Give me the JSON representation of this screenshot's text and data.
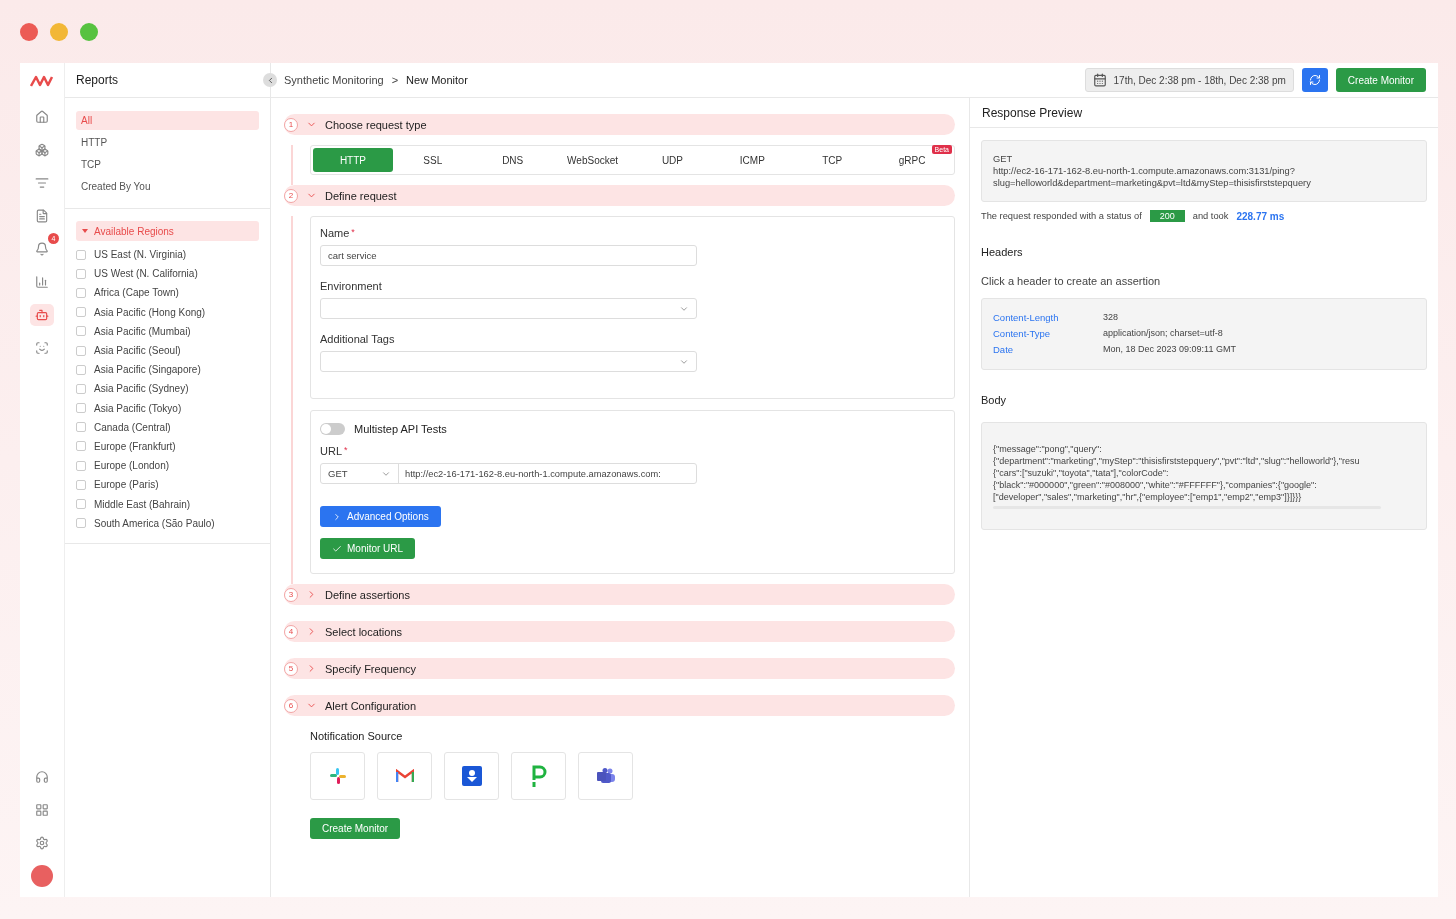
{
  "sidebar": {
    "title": "Reports",
    "filters": [
      {
        "label": "All",
        "selected": true
      },
      {
        "label": "HTTP",
        "selected": false
      },
      {
        "label": "TCP",
        "selected": false
      },
      {
        "label": "Created By You",
        "selected": false
      }
    ],
    "regions": {
      "title": "Available Regions",
      "expanded": true,
      "items": [
        {
          "label": "US East (N. Virginia)",
          "checked": false
        },
        {
          "label": "US West (N. California)",
          "checked": false
        },
        {
          "label": "Africa (Cape Town)",
          "checked": false
        },
        {
          "label": "Asia Pacific (Hong Kong)",
          "checked": false
        },
        {
          "label": "Asia Pacific (Mumbai)",
          "checked": false
        },
        {
          "label": "Asia Pacific (Seoul)",
          "checked": false
        },
        {
          "label": "Asia Pacific (Singapore)",
          "checked": false
        },
        {
          "label": "Asia Pacific (Sydney)",
          "checked": false
        },
        {
          "label": "Asia Pacific (Tokyo)",
          "checked": false
        },
        {
          "label": "Canada (Central)",
          "checked": false
        },
        {
          "label": "Europe (Frankfurt)",
          "checked": false
        },
        {
          "label": "Europe (London)",
          "checked": false
        },
        {
          "label": "Europe (Paris)",
          "checked": false
        },
        {
          "label": "Middle East (Bahrain)",
          "checked": false
        },
        {
          "label": "South America (São Paulo)",
          "checked": false
        }
      ]
    }
  },
  "rail": {
    "notification_badge": "4",
    "items": [
      {
        "kind": "home",
        "selected": false
      },
      {
        "kind": "boxes",
        "selected": false
      },
      {
        "kind": "filter",
        "selected": false
      },
      {
        "kind": "document",
        "selected": false
      },
      {
        "kind": "bell",
        "selected": false
      },
      {
        "kind": "chart",
        "selected": false
      },
      {
        "kind": "bot",
        "selected": true
      },
      {
        "kind": "scan",
        "selected": false
      }
    ]
  },
  "breadcrumb": [
    "Synthetic Monitoring",
    "New Monitor"
  ],
  "breadcrumb_separator": ">",
  "toolbar": {
    "date_range": "17th, Dec 2:38 pm - 18th, Dec 2:38 pm",
    "create_button": "Create Monitor"
  },
  "steps": [
    {
      "number": "1",
      "title": "Choose request type",
      "expanded": true,
      "kind": "types",
      "types": [
        {
          "label": "HTTP",
          "selected": true
        },
        {
          "label": "SSL",
          "selected": false
        },
        {
          "label": "DNS",
          "selected": false
        },
        {
          "label": "WebSocket",
          "selected": false
        },
        {
          "label": "UDP",
          "selected": false
        },
        {
          "label": "ICMP",
          "selected": false
        },
        {
          "label": "TCP",
          "selected": false
        },
        {
          "label": "gRPC",
          "selected": false,
          "badge": "Beta"
        }
      ]
    },
    {
      "number": "2",
      "title": "Define request",
      "expanded": true,
      "kind": "request",
      "name_label": "Name",
      "name_value": "cart service",
      "required_mark": "*",
      "environment_label": "Environment",
      "tags_label": "Additional Tags",
      "multistep": {
        "label": "Multistep API Tests",
        "on": false
      },
      "url_label": "URL",
      "method": "GET",
      "url_value": "http://ec2-16-171-162-8.eu-north-1.compute.amazonaws.com:",
      "advanced_button": "Advanced Options",
      "monitor_button": "Monitor URL"
    },
    {
      "number": "3",
      "title": "Define assertions",
      "expanded": false
    },
    {
      "number": "4",
      "title": "Select locations",
      "expanded": false
    },
    {
      "number": "5",
      "title": "Specify Frequency",
      "expanded": false
    },
    {
      "number": "6",
      "title": "Alert Configuration",
      "expanded": true,
      "kind": "alerts",
      "source_label": "Notification Source",
      "sources": [
        {
          "kind": "slack"
        },
        {
          "kind": "gmail"
        },
        {
          "kind": "download"
        },
        {
          "kind": "pager"
        },
        {
          "kind": "teams"
        }
      ],
      "submit_button": "Create Monitor"
    }
  ],
  "preview": {
    "title": "Response Preview",
    "request_lines": [
      "GET",
      "http://ec2-16-171-162-8.eu-north-1.compute.amazonaws.com:3131/ping?",
      "slug=helloworld&department=marketing&pvt=ltd&myStep=thisisfirststepquery"
    ],
    "status_prefix": "The request responded with a status of",
    "status": "200",
    "status_middle": "and took",
    "duration": "228.77 ms",
    "headers_title": "Headers",
    "headers_hint": "Click a header to create an assertion",
    "headers": [
      {
        "name": "Content-Length",
        "value": "328"
      },
      {
        "name": "Content-Type",
        "value": "application/json; charset=utf-8"
      },
      {
        "name": "Date",
        "value": "Mon, 18 Dec 2023 09:09:11 GMT"
      }
    ],
    "body_title": "Body",
    "body_lines": [
      "{\"message\":\"pong\",\"query\":",
      "{\"department\":\"marketing\",\"myStep\":\"thisisfirststepquery\",\"pvt\":\"ltd\",\"slug\":\"helloworld\"},\"resu",
      "{\"cars\":[\"suzuki\",\"toyota\",\"tata\"],\"colorCode\":",
      "{\"black\":\"#000000\",\"green\":\"#008000\",\"white\":\"#FFFFFF\"},\"companies\":{\"google\":",
      "[\"developer\",\"sales\",\"marketing\",\"hr\",{\"employee\":[\"emp1\",\"emp2\",\"emp3\"]}]}}}"
    ]
  }
}
